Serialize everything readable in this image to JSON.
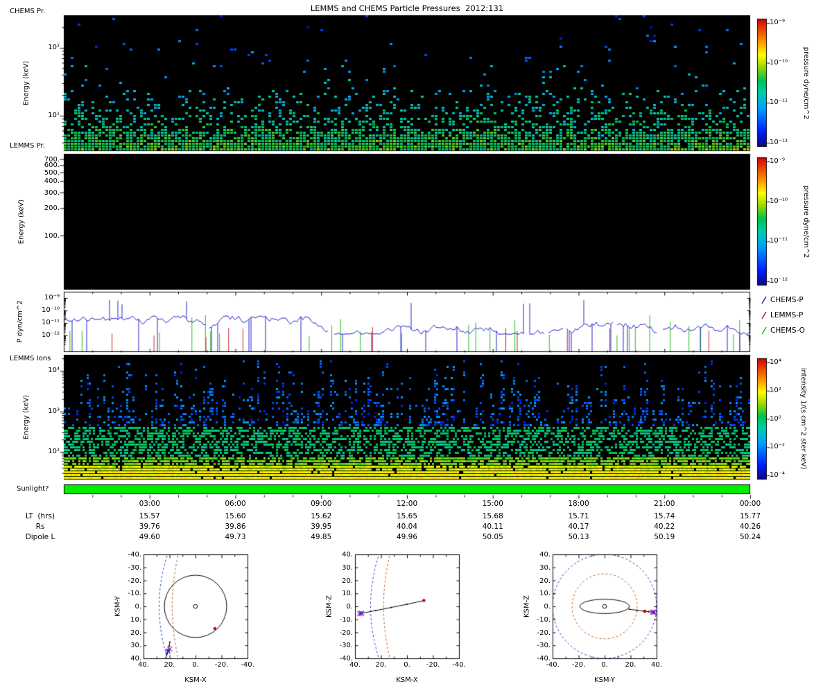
{
  "title": "LEMMS and CHEMS Particle Pressures  2012:131",
  "palette": {
    "sunlight": "#00f000",
    "boundary_blue": "#2233cc",
    "boundary_orange": "#b05a20",
    "marker_red": "#cc0000",
    "marker_blue": "#2222cc",
    "marker_magenta": "#cc22cc",
    "frame": "#000000"
  },
  "panel_chems": {
    "label": "CHEMS Pr.",
    "ylabel": "Energy (keV)",
    "yticks": [
      "10²",
      "10¹"
    ]
  },
  "panel_lemms": {
    "label": "LEMMS Pr.",
    "ylabel": "Energy (keV)",
    "yticks": [
      "700.",
      "600.",
      "500.",
      "400.",
      "300.",
      "200.",
      "100."
    ]
  },
  "panel_pressure": {
    "ylabel": "P dyn/cm^2",
    "yticks": [
      "10⁻⁹",
      "10⁻¹⁰",
      "10⁻¹¹",
      "10⁻¹²"
    ],
    "legend": [
      {
        "label": "CHEMS-P",
        "color": "#2222cc"
      },
      {
        "label": "LEMMS-P",
        "color": "#cc2222"
      },
      {
        "label": "CHEMS-O",
        "color": "#22bb22"
      }
    ]
  },
  "panel_ions": {
    "label": "LEMMS Ions",
    "ylabel": "Energy (keV)",
    "yticks": [
      "10⁴",
      "10³",
      "10²"
    ]
  },
  "sunlight": {
    "label": "Sunlight?",
    "state": "on"
  },
  "colorbar_pressure": {
    "label": "pressure dyne/cm^2",
    "ticks": [
      "10⁻⁹",
      "10⁻¹⁰",
      "10⁻¹¹",
      "10⁻¹²"
    ]
  },
  "colorbar_intensity": {
    "label": "intensity 1/(s cm^2 ster keV)",
    "ticks": [
      "10⁴",
      "10²",
      "10⁰",
      "10⁻²",
      "10⁻⁴"
    ]
  },
  "time_axis": {
    "labels": [
      "03:00",
      "06:00",
      "09:00",
      "12:00",
      "15:00",
      "18:00",
      "21:00",
      "00:00"
    ]
  },
  "ephemeris": {
    "rows": [
      {
        "label": "LT  (hrs)",
        "values": [
          "15.57",
          "15.60",
          "15.62",
          "15.65",
          "15.68",
          "15.71",
          "15.74",
          "15.77"
        ]
      },
      {
        "label": "Rs",
        "values": [
          "39.76",
          "39.86",
          "39.95",
          "40.04",
          "40.11",
          "40.17",
          "40.22",
          "40.26"
        ]
      },
      {
        "label": "Dipole L",
        "values": [
          "49.60",
          "49.73",
          "49.85",
          "49.96",
          "50.05",
          "50.13",
          "50.19",
          "50.24"
        ]
      }
    ]
  },
  "orbit_plots": [
    {
      "xlabel": "KSM-X",
      "ylabel": "KSM-Y",
      "xtick_labels": [
        "40.",
        "20.",
        "0.",
        "-20.",
        "-40."
      ],
      "ytick_labels": [
        "-40.",
        "-30.",
        "-20.",
        "-10.",
        "0.",
        "10.",
        "20.",
        "30.",
        "40."
      ]
    },
    {
      "xlabel": "KSM-X",
      "ylabel": "KSM-Z",
      "xtick_labels": [
        "40.",
        "20.",
        "0.",
        "-20.",
        "-40."
      ],
      "ytick_labels": [
        "40.",
        "30.",
        "20.",
        "10.",
        "0.",
        "-10.",
        "-20.",
        "-30.",
        "-40."
      ]
    },
    {
      "xlabel": "KSM-Y",
      "ylabel": "KSM-Z",
      "xtick_labels": [
        "-40.",
        "-20.",
        "0.",
        "20.",
        "40."
      ],
      "ytick_labels": [
        "40.",
        "30.",
        "20.",
        "10.",
        "0.",
        "-10.",
        "-20.",
        "-30.",
        "-40."
      ]
    }
  ],
  "chart_data": [
    {
      "type": "heatmap",
      "panel": "CHEMS Pr.",
      "x_axis": "time 00:00-24:00 of 2012:131",
      "y_scale": "log",
      "y_range_keV": [
        3,
        300
      ],
      "z_label": "pressure dyne/cm^2",
      "z_range_log10": [
        -12,
        -9
      ],
      "appearance": "sparse blue specks above ~10 keV, dense blue-cyan-green band below ~8 keV",
      "seed": 20121311
    },
    {
      "type": "heatmap",
      "panel": "LEMMS Pr.",
      "y_scale": "log",
      "y_range_keV": [
        25,
        800
      ],
      "z_label": "pressure dyne/cm^2",
      "z_range_log10": [
        -12,
        -9
      ],
      "appearance": "no counts above threshold; panel entirely black"
    },
    {
      "type": "line",
      "panel": "P dyn/cm^2",
      "y_scale": "log",
      "ylim_log10": [
        -13.3,
        -8.5
      ],
      "series": [
        {
          "name": "CHEMS-P",
          "color": "#2222cc",
          "typical_level_log10": -11,
          "style": "continuous with gaps and vertical excursions"
        },
        {
          "name": "LEMMS-P",
          "color": "#cc2222",
          "typical_level_log10": -11.8,
          "style": "sparse vertical spikes from bottom"
        },
        {
          "name": "CHEMS-O",
          "color": "#22bb22",
          "typical_level_log10": -11,
          "style": "sparse vertical spikes up to ~1e-10.4"
        }
      ],
      "seed": 431
    },
    {
      "type": "heatmap",
      "panel": "LEMMS Ions",
      "y_scale": "log",
      "y_range_keV": [
        20,
        25000
      ],
      "z_label": "intensity 1/(s cm^2 ster keV)",
      "z_range_log10": [
        -5,
        4
      ],
      "appearance": "bright yellow band below ~150 keV, green 150-600 keV, blue speckled columns of varying height above",
      "seed": 77
    },
    {
      "type": "indicator",
      "panel": "Sunlight?",
      "value": "on",
      "color": "#00f000"
    },
    {
      "type": "scatter",
      "panel": "KSM-X vs KSM-Y",
      "x_range": [
        40,
        -40
      ],
      "y_range": [
        -40,
        40
      ],
      "titan_orbit_radius": 24,
      "planet_radius": 1.5,
      "magnetopause": {
        "nose": 28,
        "flare": 0.004
      },
      "bow_shock": {
        "nose": 18,
        "flare": 0.003
      },
      "trajectory": [
        [
          23,
          40
        ],
        [
          21.8,
          36.5
        ],
        [
          20.8,
          33.5
        ],
        [
          20.2,
          30.5
        ],
        [
          19.8,
          27.5
        ]
      ],
      "red_dots": [
        [
          -14.9,
          17.1
        ],
        [
          20.8,
          33.8
        ]
      ],
      "blue_x": [
        [
          21.2,
          34.5
        ]
      ],
      "magenta_x": [
        [
          19.8,
          32.8
        ]
      ]
    },
    {
      "type": "scatter",
      "panel": "KSM-X vs KSM-Z",
      "x_range": [
        40,
        -40
      ],
      "y_range": [
        40,
        -40
      ],
      "magnetopause": {
        "nose": 28,
        "flare": 0.004
      },
      "bow_shock": {
        "nose": 18,
        "flare": 0.003
      },
      "trajectory": [
        [
          36,
          -5.5
        ],
        [
          24,
          -3.2
        ],
        [
          12,
          -0.8
        ],
        [
          0,
          1.6
        ],
        [
          -13,
          4.5
        ]
      ],
      "red_dots": [
        [
          -13,
          4.5
        ],
        [
          36,
          -5.5
        ]
      ],
      "blue_x": [
        [
          35,
          -5.3
        ]
      ],
      "magenta_x": [
        [
          36.5,
          -5.6
        ]
      ]
    },
    {
      "type": "scatter",
      "panel": "KSM-Y vs KSM-Z",
      "x_range": [
        -40,
        40
      ],
      "y_range": [
        40,
        -40
      ],
      "rings_ellipse": {
        "rx": 19,
        "ry": 5.5
      },
      "planet_radius": 1.5,
      "magnetopause_circle_r": 40,
      "bow_shock_circle_r": 25,
      "trajectory": [
        [
          19,
          -2.2
        ],
        [
          25,
          -3
        ],
        [
          30,
          -3.6
        ],
        [
          34,
          -4.1
        ],
        [
          37.5,
          -4.5
        ]
      ],
      "red_dots": [
        [
          31,
          -3.8
        ],
        [
          37.5,
          -4.5
        ]
      ],
      "blue_x": [
        [
          38,
          -4.5
        ]
      ],
      "magenta_x": [
        [
          36.8,
          -4.4
        ]
      ]
    },
    {
      "type": "table",
      "name": "ephemeris",
      "columns": [
        "03:00",
        "06:00",
        "09:00",
        "12:00",
        "15:00",
        "18:00",
        "21:00",
        "00:00"
      ],
      "rows": [
        [
          "LT  (hrs)",
          "15.57",
          "15.60",
          "15.62",
          "15.65",
          "15.68",
          "15.71",
          "15.74",
          "15.77"
        ],
        [
          "Rs",
          "39.76",
          "39.86",
          "39.95",
          "40.04",
          "40.11",
          "40.17",
          "40.22",
          "40.26"
        ],
        [
          "Dipole L",
          "49.60",
          "49.73",
          "49.85",
          "49.96",
          "50.05",
          "50.13",
          "50.19",
          "50.24"
        ]
      ]
    }
  ]
}
